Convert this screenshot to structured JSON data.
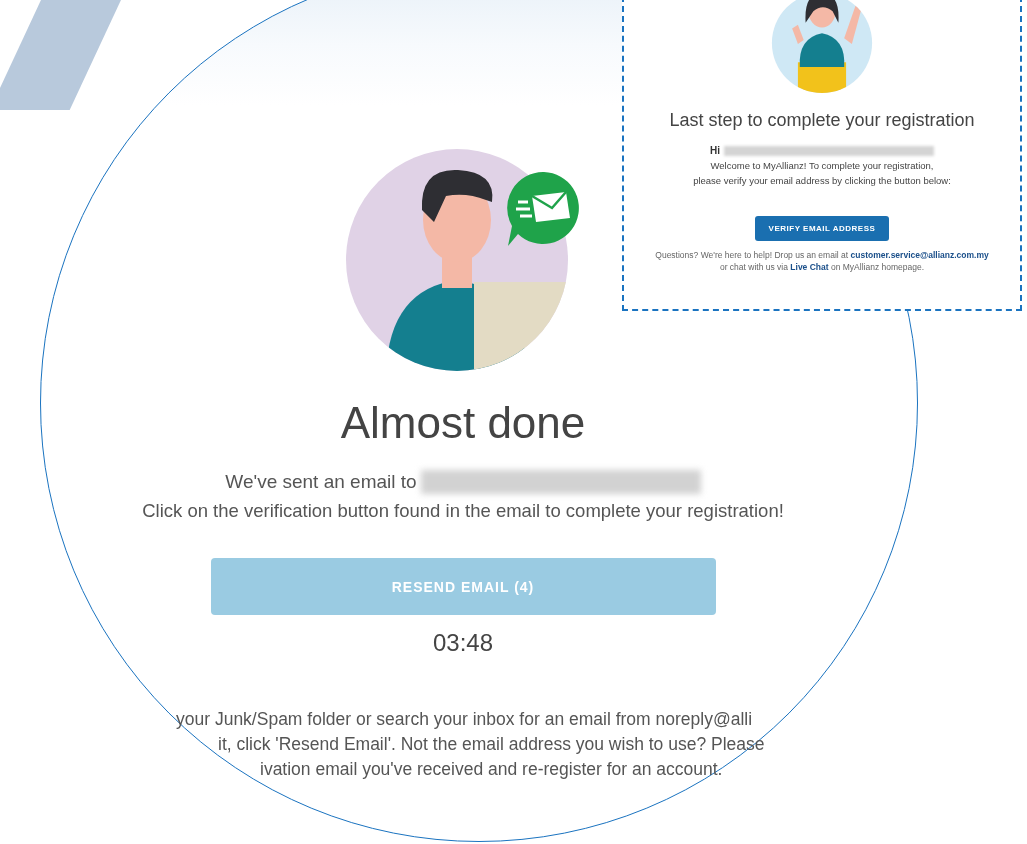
{
  "page": {
    "heading": "Almost done",
    "sent_prefix": "We've sent an email to",
    "instruction": "Click on the verification button found in the email to complete your registration!",
    "resend_button": {
      "label": "RESEND EMAIL (4)",
      "disabled": true
    },
    "timer": "03:48",
    "help_lines": [
      "your Junk/Spam folder or search your inbox for an email from noreply@alli",
      "it, click 'Resend Email'. Not the email address you wish to use? Please",
      "ivation email you've received and re-register for an account."
    ]
  },
  "email_preview": {
    "heading": "Last step to complete your registration",
    "greeting": "Hi",
    "body_lines": [
      "Welcome to MyAllianz! To complete your registration,",
      "please verify your email address by clicking the button below:"
    ],
    "button": "VERIFY EMAIL ADDRESS",
    "footer": {
      "text_before": "Questions? We're here to help! Drop us an email at",
      "email_link": "customer.service@allianz.com.my",
      "text_mid": "or chat with us via",
      "chat_link": "Live Chat",
      "text_after": "on MyAllianz homepage."
    }
  }
}
